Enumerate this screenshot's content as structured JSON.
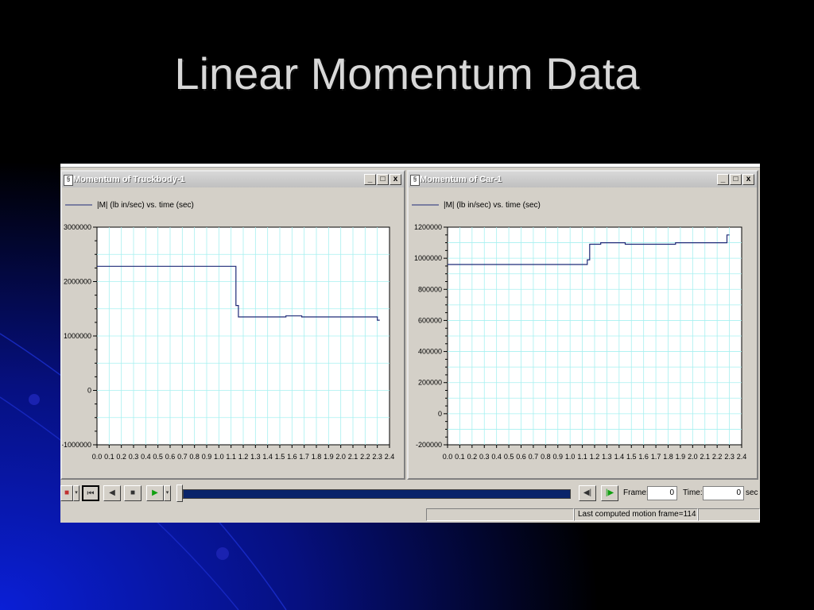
{
  "slide": {
    "title": "Linear Momentum Data"
  },
  "colors": {
    "slide_bg": "#000000",
    "accent_blue": "#1a1ad0",
    "window_bg": "#d4d0c8",
    "grid": "#a6f0f0",
    "trace": "#1e2a78"
  },
  "windows": [
    {
      "title": "Momentum of Truckbody-1",
      "buttons": [
        "_",
        "□",
        "x"
      ]
    },
    {
      "title": "Momentum of Car-1",
      "buttons": [
        "_",
        "□",
        "x"
      ]
    }
  ],
  "chart_data": [
    {
      "type": "line",
      "legend": "|M| (lb in/sec)  vs. time (sec)",
      "xlim": [
        0,
        2.4
      ],
      "ylim": [
        -1000000,
        3000000
      ],
      "x_ticks": [
        "0.0",
        "0.1",
        "0.2",
        "0.3",
        "0.4",
        "0.5",
        "0.6",
        "0.7",
        "0.8",
        "0.9",
        "1.0",
        "1.1",
        "1.2",
        "1.3",
        "1.4",
        "1.5",
        "1.6",
        "1.7",
        "1.8",
        "1.9",
        "2.0",
        "2.1",
        "2.2",
        "2.3",
        "2.4"
      ],
      "y_ticks": [
        "3000000",
        "2000000",
        "1000000",
        "0",
        "-1000000"
      ],
      "y_tick_values": [
        3000000,
        2000000,
        1000000,
        0,
        -1000000
      ],
      "grid": true,
      "series": [
        {
          "values": [
            [
              0,
              2280000
            ],
            [
              1.14,
              2280000
            ],
            [
              1.14,
              1560000
            ],
            [
              1.16,
              1560000
            ],
            [
              1.16,
              1350000
            ],
            [
              1.55,
              1350000
            ],
            [
              1.55,
              1370000
            ],
            [
              1.68,
              1370000
            ],
            [
              1.68,
              1350000
            ],
            [
              2.3,
              1350000
            ],
            [
              2.3,
              1290000
            ],
            [
              2.32,
              1290000
            ]
          ]
        }
      ]
    },
    {
      "type": "line",
      "legend": "|M| (lb in/sec)  vs. time (sec)",
      "xlim": [
        0,
        2.4
      ],
      "ylim": [
        -200000,
        1200000
      ],
      "x_ticks": [
        "0.0",
        "0.1",
        "0.2",
        "0.3",
        "0.4",
        "0.5",
        "0.6",
        "0.7",
        "0.8",
        "0.9",
        "1.0",
        "1.1",
        "1.2",
        "1.3",
        "1.4",
        "1.5",
        "1.6",
        "1.7",
        "1.8",
        "1.9",
        "2.0",
        "2.1",
        "2.2",
        "2.3",
        "2.4"
      ],
      "y_ticks": [
        "1200000",
        "1000000",
        "800000",
        "600000",
        "400000",
        "200000",
        "0",
        "-200000"
      ],
      "y_tick_values": [
        1200000,
        1000000,
        800000,
        600000,
        400000,
        200000,
        0,
        -200000
      ],
      "grid": true,
      "series": [
        {
          "values": [
            [
              0,
              960000
            ],
            [
              1.14,
              960000
            ],
            [
              1.14,
              990000
            ],
            [
              1.16,
              990000
            ],
            [
              1.16,
              1090000
            ],
            [
              1.25,
              1090000
            ],
            [
              1.25,
              1100000
            ],
            [
              1.45,
              1100000
            ],
            [
              1.45,
              1090000
            ],
            [
              1.86,
              1090000
            ],
            [
              1.86,
              1100000
            ],
            [
              2.28,
              1100000
            ],
            [
              2.28,
              1150000
            ],
            [
              2.3,
              1150000
            ]
          ]
        }
      ]
    }
  ],
  "transport": {
    "frame_label": "Frame:",
    "frame_value": "0",
    "time_label": "Time:",
    "time_value": "0",
    "time_unit": "sec"
  },
  "status": {
    "message": "Last computed motion frame=114"
  }
}
